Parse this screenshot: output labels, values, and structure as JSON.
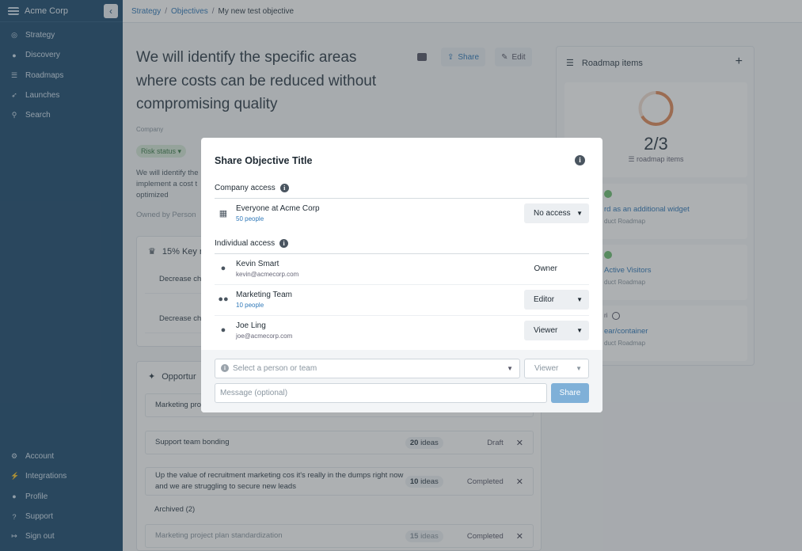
{
  "app": {
    "brand": "Acme Corp",
    "collapse_glyph": "‹"
  },
  "sidebar": {
    "top": [
      {
        "label": "Strategy",
        "icon": "target-icon"
      },
      {
        "label": "Discovery",
        "icon": "bulb-icon"
      },
      {
        "label": "Roadmaps",
        "icon": "list-icon"
      },
      {
        "label": "Launches",
        "icon": "rocket-icon"
      },
      {
        "label": "Search",
        "icon": "search-icon"
      }
    ],
    "bottom": [
      {
        "label": "Account",
        "icon": "gear-icon"
      },
      {
        "label": "Integrations",
        "icon": "plug-icon"
      },
      {
        "label": "Profile",
        "icon": "user-icon"
      },
      {
        "label": "Support",
        "icon": "help-icon"
      },
      {
        "label": "Sign out",
        "icon": "signout-icon"
      }
    ]
  },
  "breadcrumb": {
    "items": [
      "Strategy",
      "Objectives"
    ],
    "sep": "/",
    "current": "My new test objective"
  },
  "objective": {
    "title": "We will identify the specific areas where costs can be reduced without compromising quality",
    "company_label": "Company",
    "risk_label": "Risk status",
    "description": "We will identify the implement a cost t optimized",
    "owned": "Owned by Person",
    "share_label": "Share",
    "edit_label": "Edit"
  },
  "key_results": {
    "title": "15% Key r",
    "rows": [
      "Decrease ch",
      "Decrease ch"
    ]
  },
  "opportunities": {
    "title": "Opportur",
    "rows": [
      {
        "text": "Marketing pro",
        "ideas": "",
        "ideas_label": "",
        "status": ""
      },
      {
        "text": "Support team bonding",
        "ideas": "20",
        "ideas_label": "ideas",
        "status": "Draft"
      },
      {
        "text": "Up the value of recruitment marketing cos it's really in the dumps right now and we are struggling to secure new leads",
        "ideas": "10",
        "ideas_label": "ideas",
        "status": "Completed"
      }
    ],
    "archived_label": "Archived (2)",
    "archived_rows": [
      {
        "text": "Marketing project plan standardization",
        "ideas": "15",
        "ideas_label": "ideas",
        "status": "Completed"
      }
    ]
  },
  "roadmap": {
    "title": "Roadmap items",
    "count": "2/3",
    "count_label": "roadmap items",
    "progress_fraction": 0.6667,
    "items": [
      {
        "link": "rd as an additional widget",
        "meta": "duct Roadmap"
      },
      {
        "link": "Active Visitors",
        "meta": "duct Roadmap"
      },
      {
        "link": "ear/container",
        "meta": "duct Roadmap",
        "prefix": "ri"
      }
    ]
  },
  "modal": {
    "title": "Share Objective Title",
    "company_access": "Company access",
    "company_row": {
      "name": "Everyone at Acme Corp",
      "sub": "50 people",
      "role": "No access"
    },
    "individual_access": "Individual access",
    "people": [
      {
        "name": "Kevin Smart",
        "sub": "kevin@acmecorp.com",
        "role": "Owner",
        "icon": "person-icon",
        "dropdown": false
      },
      {
        "name": "Marketing Team",
        "sub": "10 people",
        "role": "Editor",
        "icon": "team-icon",
        "dropdown": true
      },
      {
        "name": "Joe Ling",
        "sub": "joe@acmecorp.com",
        "role": "Viewer",
        "icon": "person-icon",
        "dropdown": true
      }
    ],
    "select_placeholder": "Select a person or team",
    "viewer_label": "Viewer",
    "message_placeholder": "Message (optional)",
    "share_button": "Share"
  },
  "colors": {
    "sidebar": "#1d4a6e",
    "accent": "#2f78b8",
    "share_disabled": "#7fb0d8"
  }
}
